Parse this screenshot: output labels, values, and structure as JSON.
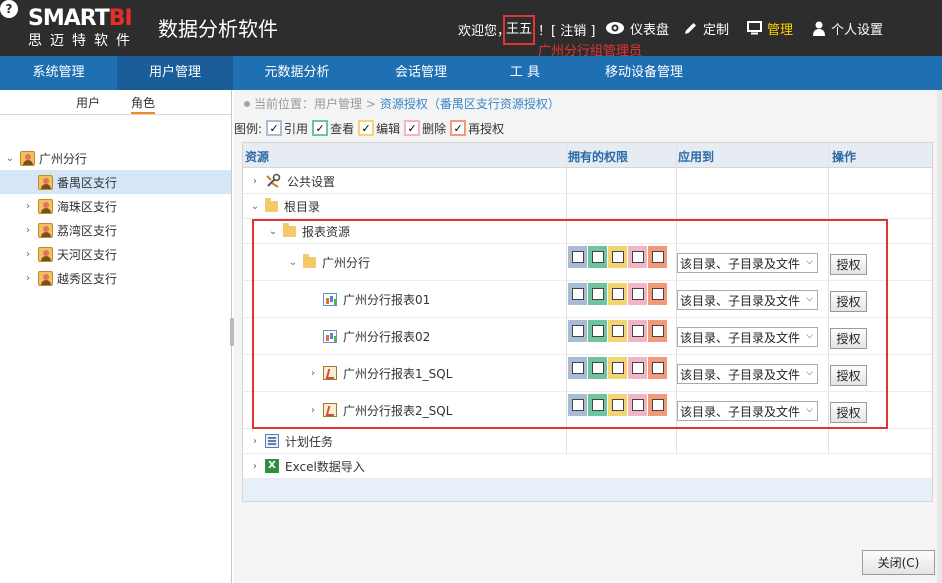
{
  "header": {
    "logo_text_a": "SMART",
    "logo_text_b": "BI",
    "logo_sub": "思迈特软件",
    "app_title": "数据分析软件",
    "welcome_prefix": "欢迎您，",
    "username": "王五",
    "welcome_suffix": "！[ 注销 ]",
    "annotation": "广州分行组管理员",
    "buttons": {
      "dashboard": "仪表盘",
      "custom": "定制",
      "manage": "管理",
      "personal": "个人设置",
      "help": "?"
    },
    "manage_color": "#ffd200",
    "annotation_color": "#e53333"
  },
  "nav": {
    "items": [
      "系统管理",
      "用户管理",
      "元数据分析",
      "会话管理",
      "工 具",
      "移动设备管理"
    ],
    "active": "用户管理",
    "bg_color": "#1f6fb3"
  },
  "sidebar": {
    "tabs": [
      "用户",
      "角色"
    ],
    "active_tab": "角色",
    "tree": [
      {
        "label": "广州分行",
        "level": 0,
        "expanded": true
      },
      {
        "label": "番禺区支行",
        "level": 1,
        "selected": true
      },
      {
        "label": "海珠区支行",
        "level": 1
      },
      {
        "label": "荔湾区支行",
        "level": 1
      },
      {
        "label": "天河区支行",
        "level": 1
      },
      {
        "label": "越秀区支行",
        "level": 1
      }
    ]
  },
  "breadcrumb": {
    "prefix": "当前位置：用户管理 > ",
    "current": "资源授权（番禺区支行资源授权）"
  },
  "legend": {
    "label": "图例:",
    "items": [
      "引用",
      "查看",
      "编辑",
      "删除",
      "再授权"
    ],
    "colors": [
      "#a9bcd6",
      "#6fc4a0",
      "#f3d471",
      "#f3b5c6",
      "#f29a78"
    ]
  },
  "grid": {
    "headers": {
      "resource": "资源",
      "permission": "拥有的权限",
      "apply_to": "应用到",
      "action": "操作"
    },
    "rows": [
      {
        "label": "公共设置",
        "level": 0,
        "arrow": "›",
        "icon": "gear-icon"
      },
      {
        "label": "根目录",
        "level": 0,
        "arrow": "⌄",
        "icon": "folder-icon"
      },
      {
        "label": "报表资源",
        "level": 1,
        "arrow": "⌄",
        "icon": "folder-icon"
      },
      {
        "label": "广州分行",
        "level": 2,
        "arrow": "⌄",
        "icon": "folder-icon",
        "perm": true
      },
      {
        "label": "广州分行报表01",
        "level": 3,
        "arrow": "",
        "icon": "report-icon",
        "perm": true
      },
      {
        "label": "广州分行报表02",
        "level": 3,
        "arrow": "",
        "icon": "report-icon",
        "perm": true
      },
      {
        "label": "广州分行报表1_SQL",
        "level": 3,
        "arrow": "›",
        "icon": "sql-icon",
        "perm": true
      },
      {
        "label": "广州分行报表2_SQL",
        "level": 3,
        "arrow": "›",
        "icon": "sql-icon",
        "perm": true
      },
      {
        "label": "计划任务",
        "level": 0,
        "arrow": "›",
        "icon": "task-icon"
      },
      {
        "label": "Excel数据导入",
        "level": 0,
        "arrow": "›",
        "icon": "excel-icon"
      }
    ],
    "apply_option": "该目录、子目录及文件",
    "grant_label": "授权"
  },
  "footer": {
    "close_label": "关闭(C)"
  }
}
